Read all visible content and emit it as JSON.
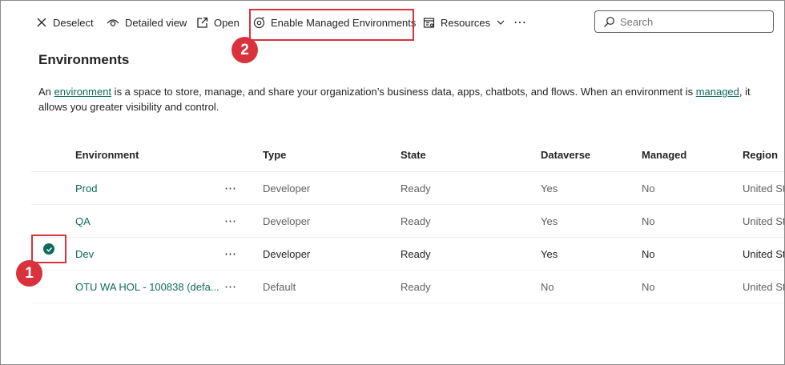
{
  "toolbar": {
    "deselect_label": "Deselect",
    "detailed_view_label": "Detailed view",
    "open_label": "Open",
    "enable_managed_label": "Enable Managed Environments",
    "resources_label": "Resources",
    "more_label": "⋯"
  },
  "search": {
    "placeholder": "Search"
  },
  "callouts": {
    "first": "1",
    "second": "2"
  },
  "page": {
    "title": "Environments",
    "desc_part1": "An ",
    "desc_link1": "environment",
    "desc_part2": " is a space to store, manage, and share your organization’s business data, apps, chatbots, and flows. When an environment is ",
    "desc_link2": "managed",
    "desc_part3": ", it allows you greater visibility and control."
  },
  "table": {
    "headers": {
      "environment": "Environment",
      "type": "Type",
      "state": "State",
      "dataverse": "Dataverse",
      "managed": "Managed",
      "region": "Region"
    },
    "more_label": "⋯",
    "rows": [
      {
        "environment": "Prod",
        "type": "Developer",
        "state": "Ready",
        "dataverse": "Yes",
        "managed": "No",
        "region": "United Sta"
      },
      {
        "environment": "QA",
        "type": "Developer",
        "state": "Ready",
        "dataverse": "Yes",
        "managed": "No",
        "region": "United Sta"
      },
      {
        "environment": "Dev",
        "type": "Developer",
        "state": "Ready",
        "dataverse": "Yes",
        "managed": "No",
        "region": "United Sta"
      },
      {
        "environment": "OTU WA HOL - 100838 (defa...",
        "type": "Default",
        "state": "Ready",
        "dataverse": "No",
        "managed": "No",
        "region": "United Sta"
      }
    ]
  },
  "colors": {
    "accent": "#0f6a5a",
    "callout": "#d9323c"
  }
}
